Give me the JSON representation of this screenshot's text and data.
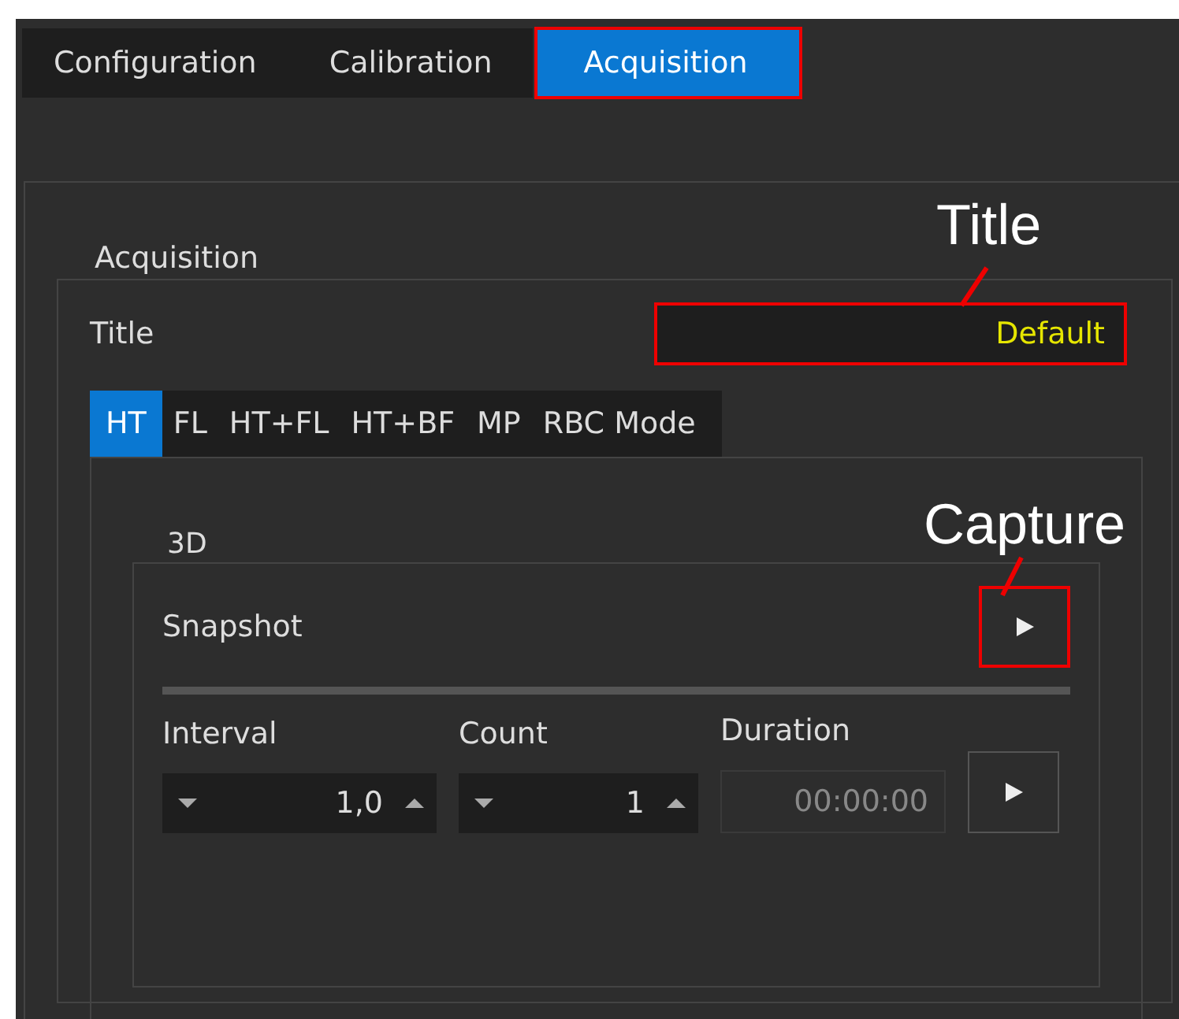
{
  "tabs": [
    {
      "label": "Configuration",
      "selected": false
    },
    {
      "label": "Calibration",
      "selected": false
    },
    {
      "label": "Acquisition",
      "selected": true
    }
  ],
  "group": {
    "legend": "Acquisition",
    "title_label": "Title",
    "title_value": "Default"
  },
  "mode_tabs": [
    {
      "label": "HT",
      "selected": true
    },
    {
      "label": "FL",
      "selected": false
    },
    {
      "label": "HT+FL",
      "selected": false
    },
    {
      "label": "HT+BF",
      "selected": false
    },
    {
      "label": "MP",
      "selected": false
    },
    {
      "label": "RBC Mode",
      "selected": false
    }
  ],
  "section": {
    "legend": "3D",
    "snapshot_label": "Snapshot",
    "fields": [
      {
        "label": "Interval",
        "kind": "spin",
        "value": "1,0"
      },
      {
        "label": "Count",
        "kind": "spin",
        "value": "1"
      },
      {
        "label": "Duration",
        "kind": "readonly",
        "value": "00:00:00"
      }
    ]
  },
  "annotations": [
    {
      "text": "Title"
    },
    {
      "text": "Capture"
    }
  ]
}
